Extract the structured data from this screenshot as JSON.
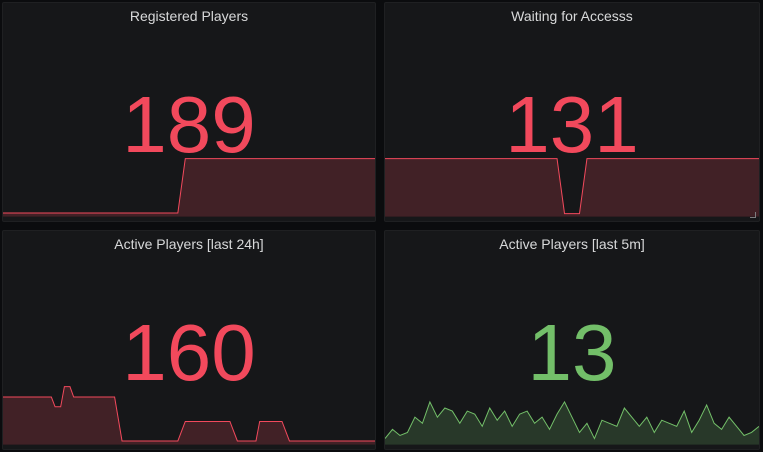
{
  "colors": {
    "red": "#f2495c",
    "green": "#73bf69"
  },
  "panels": [
    {
      "title": "Registered Players",
      "value": "189",
      "color": "red",
      "spark": [
        [
          0,
          0.06
        ],
        [
          0.47,
          0.06
        ],
        [
          0.49,
          0.95
        ],
        [
          1,
          0.95
        ]
      ]
    },
    {
      "title": "Waiting for Accesss",
      "value": "131",
      "color": "red",
      "spark": [
        [
          0,
          0.95
        ],
        [
          0.46,
          0.95
        ],
        [
          0.48,
          0.05
        ],
        [
          0.52,
          0.05
        ],
        [
          0.54,
          0.95
        ],
        [
          1,
          0.95
        ]
      ]
    },
    {
      "title": "Active Players [last 24h]",
      "value": "160",
      "color": "red",
      "spark": [
        [
          0,
          0.78
        ],
        [
          0.13,
          0.78
        ],
        [
          0.14,
          0.62
        ],
        [
          0.155,
          0.62
        ],
        [
          0.165,
          0.95
        ],
        [
          0.18,
          0.95
        ],
        [
          0.19,
          0.78
        ],
        [
          0.3,
          0.78
        ],
        [
          0.32,
          0.06
        ],
        [
          0.47,
          0.06
        ],
        [
          0.49,
          0.38
        ],
        [
          0.61,
          0.38
        ],
        [
          0.63,
          0.06
        ],
        [
          0.68,
          0.06
        ],
        [
          0.69,
          0.38
        ],
        [
          0.75,
          0.38
        ],
        [
          0.77,
          0.06
        ],
        [
          1,
          0.06
        ]
      ]
    },
    {
      "title": "Active Players [last 5m]",
      "value": "13",
      "color": "green",
      "spark": [
        [
          0,
          0.1
        ],
        [
          0.02,
          0.25
        ],
        [
          0.04,
          0.15
        ],
        [
          0.06,
          0.2
        ],
        [
          0.08,
          0.45
        ],
        [
          0.1,
          0.35
        ],
        [
          0.12,
          0.7
        ],
        [
          0.14,
          0.45
        ],
        [
          0.16,
          0.6
        ],
        [
          0.18,
          0.55
        ],
        [
          0.2,
          0.35
        ],
        [
          0.22,
          0.55
        ],
        [
          0.24,
          0.5
        ],
        [
          0.26,
          0.3
        ],
        [
          0.28,
          0.6
        ],
        [
          0.3,
          0.4
        ],
        [
          0.32,
          0.55
        ],
        [
          0.34,
          0.3
        ],
        [
          0.36,
          0.5
        ],
        [
          0.38,
          0.55
        ],
        [
          0.4,
          0.35
        ],
        [
          0.42,
          0.45
        ],
        [
          0.44,
          0.25
        ],
        [
          0.46,
          0.5
        ],
        [
          0.48,
          0.7
        ],
        [
          0.5,
          0.45
        ],
        [
          0.52,
          0.2
        ],
        [
          0.54,
          0.35
        ],
        [
          0.56,
          0.1
        ],
        [
          0.58,
          0.4
        ],
        [
          0.6,
          0.35
        ],
        [
          0.62,
          0.3
        ],
        [
          0.64,
          0.6
        ],
        [
          0.66,
          0.45
        ],
        [
          0.68,
          0.3
        ],
        [
          0.7,
          0.45
        ],
        [
          0.72,
          0.2
        ],
        [
          0.74,
          0.4
        ],
        [
          0.76,
          0.35
        ],
        [
          0.78,
          0.3
        ],
        [
          0.8,
          0.55
        ],
        [
          0.82,
          0.2
        ],
        [
          0.84,
          0.4
        ],
        [
          0.86,
          0.65
        ],
        [
          0.88,
          0.35
        ],
        [
          0.9,
          0.25
        ],
        [
          0.92,
          0.45
        ],
        [
          0.94,
          0.3
        ],
        [
          0.96,
          0.15
        ],
        [
          0.98,
          0.2
        ],
        [
          1,
          0.3
        ]
      ]
    }
  ]
}
